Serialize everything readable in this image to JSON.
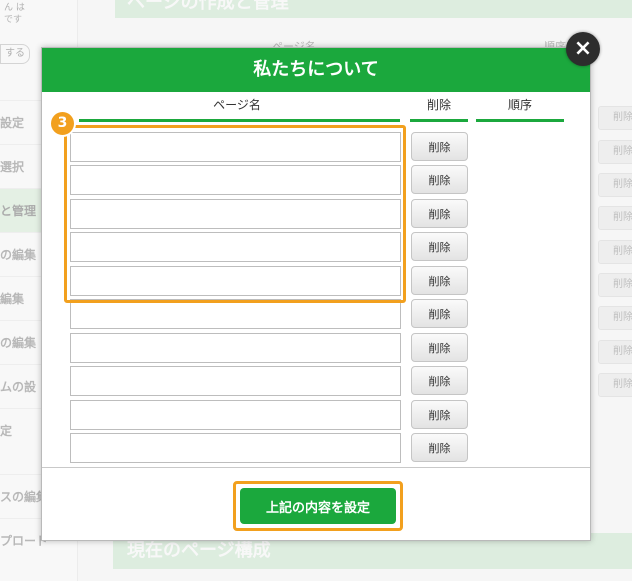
{
  "background": {
    "sidebar_top_text": [
      "ん は",
      "です"
    ],
    "sidebar_button": "する",
    "sidebar_items": [
      "設定",
      "選択",
      "と管理",
      "の編集",
      "編集",
      "の編集",
      "ムの設",
      "定",
      "スの編集",
      "プロード"
    ],
    "header_title": "ページの作成と管理",
    "col_page_name": "ページ名",
    "col_order": "順序",
    "right_button_label": "削除",
    "bottom_title": "現在のページ構成"
  },
  "modal": {
    "title": "私たちについて",
    "close_icon": "×",
    "columns": {
      "page_name": "ページ名",
      "delete": "削除",
      "order": "順序"
    },
    "rows": [
      {
        "value": "",
        "delete_label": "削除"
      },
      {
        "value": "",
        "delete_label": "削除"
      },
      {
        "value": "",
        "delete_label": "削除"
      },
      {
        "value": "",
        "delete_label": "削除"
      },
      {
        "value": "",
        "delete_label": "削除"
      },
      {
        "value": "",
        "delete_label": "削除"
      },
      {
        "value": "",
        "delete_label": "削除"
      },
      {
        "value": "",
        "delete_label": "削除"
      },
      {
        "value": "",
        "delete_label": "削除"
      },
      {
        "value": "",
        "delete_label": "削除"
      }
    ],
    "step_badge": "3",
    "submit_label": "上記の内容を設定"
  },
  "colors": {
    "accent_green": "#1ba83d",
    "highlight_orange": "#f2a01e",
    "close_dark": "#2d2d2d"
  }
}
